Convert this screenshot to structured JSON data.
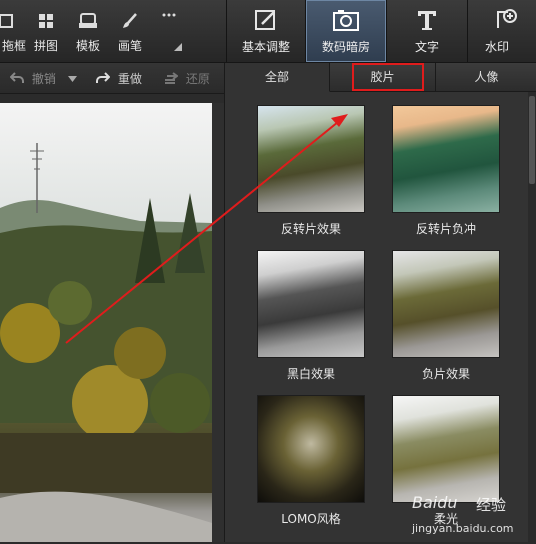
{
  "left_tools": [
    {
      "label": "拖框",
      "icon": "crop-icon"
    },
    {
      "label": "拼图",
      "icon": "collage-icon"
    },
    {
      "label": "模板",
      "icon": "template-icon"
    },
    {
      "label": "画笔",
      "icon": "brush-icon"
    },
    {
      "label": "",
      "icon": "more-icon"
    }
  ],
  "main_tabs": [
    {
      "label": "基本调整",
      "icon": "adjust-icon",
      "active": false
    },
    {
      "label": "数码暗房",
      "icon": "camera-icon",
      "active": true
    },
    {
      "label": "文字",
      "icon": "text-icon",
      "active": false
    },
    {
      "label": "水印",
      "icon": "watermark-icon",
      "active": false
    }
  ],
  "edit_toolbar": {
    "undo": "撤销",
    "redo": "重做",
    "restore": "还原"
  },
  "filter_tabs": [
    {
      "label": "全部",
      "active": true
    },
    {
      "label": "胶片",
      "active": false,
      "highlighted": true
    },
    {
      "label": "人像",
      "active": false
    }
  ],
  "filters": [
    {
      "label": "反转片效果"
    },
    {
      "label": "反转片负冲"
    },
    {
      "label": "黑白效果"
    },
    {
      "label": "负片效果"
    },
    {
      "label": "LOMO风格"
    },
    {
      "label": "柔光"
    }
  ],
  "watermark": {
    "brand": "Baidu",
    "text": "经验",
    "url": "jingyan.baidu.com"
  },
  "colors": {
    "highlight": "#e01c1c",
    "arrow": "#e01c1c",
    "active_tab": "#3d4d62"
  }
}
